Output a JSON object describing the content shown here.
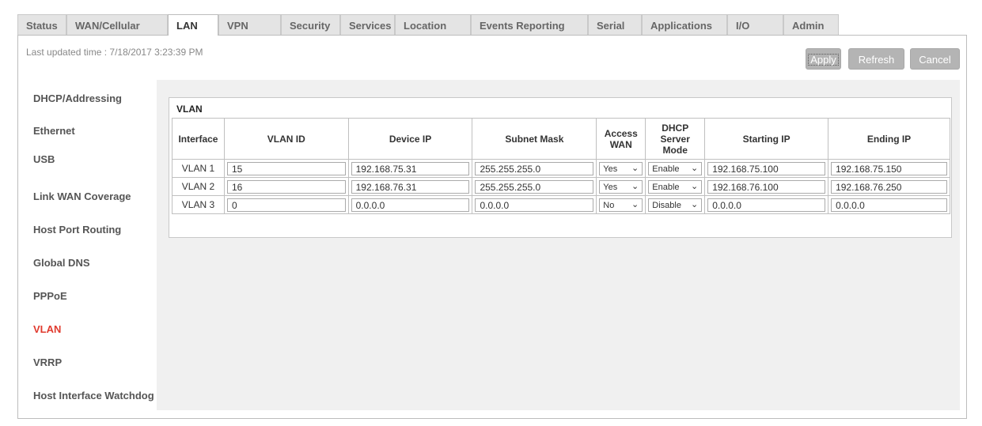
{
  "tabs": [
    {
      "label": "Status",
      "active": false
    },
    {
      "label": "WAN/Cellular",
      "active": false
    },
    {
      "label": "LAN",
      "active": true
    },
    {
      "label": "VPN",
      "active": false
    },
    {
      "label": "Security",
      "active": false
    },
    {
      "label": "Services",
      "active": false
    },
    {
      "label": "Location",
      "active": false
    },
    {
      "label": "Events Reporting",
      "active": false
    },
    {
      "label": "Serial",
      "active": false
    },
    {
      "label": "Applications",
      "active": false
    },
    {
      "label": "I/O",
      "active": false
    },
    {
      "label": "Admin",
      "active": false
    }
  ],
  "header": {
    "last_updated": "Last updated time : 7/18/2017 3:23:39 PM",
    "apply_label": "Apply",
    "refresh_label": "Refresh",
    "cancel_label": "Cancel"
  },
  "sidebar": {
    "items": [
      {
        "label": "DHCP/Addressing",
        "active": false
      },
      {
        "label": "Ethernet",
        "active": false
      },
      {
        "label": "USB",
        "active": false
      },
      {
        "label": "Link WAN Coverage",
        "active": false
      },
      {
        "label": "Host Port Routing",
        "active": false
      },
      {
        "label": "Global DNS",
        "active": false
      },
      {
        "label": "PPPoE",
        "active": false
      },
      {
        "label": "VLAN",
        "active": true
      },
      {
        "label": "VRRP",
        "active": false
      },
      {
        "label": "Host Interface Watchdog",
        "active": false
      }
    ]
  },
  "vlan": {
    "title": "VLAN",
    "columns": [
      "Interface",
      "VLAN ID",
      "Device IP",
      "Subnet Mask",
      "Access WAN",
      "DHCP Server Mode",
      "Starting IP",
      "Ending IP"
    ],
    "rows": [
      {
        "interface": "VLAN 1",
        "vlan_id": "15",
        "device_ip": "192.168.75.31",
        "subnet_mask": "255.255.255.0",
        "access_wan": "Yes",
        "dhcp_mode": "Enable",
        "start_ip": "192.168.75.100",
        "end_ip": "192.168.75.150"
      },
      {
        "interface": "VLAN 2",
        "vlan_id": "16",
        "device_ip": "192.168.76.31",
        "subnet_mask": "255.255.255.0",
        "access_wan": "Yes",
        "dhcp_mode": "Enable",
        "start_ip": "192.168.76.100",
        "end_ip": "192.168.76.250"
      },
      {
        "interface": "VLAN 3",
        "vlan_id": "0",
        "device_ip": "0.0.0.0",
        "subnet_mask": "0.0.0.0",
        "access_wan": "No",
        "dhcp_mode": "Disable",
        "start_ip": "0.0.0.0",
        "end_ip": "0.0.0.0"
      }
    ]
  },
  "colors": {
    "active_sidebar": "#e03a2e",
    "button_gray": "#b4b4b4",
    "content_bg": "#f0f0f0"
  }
}
